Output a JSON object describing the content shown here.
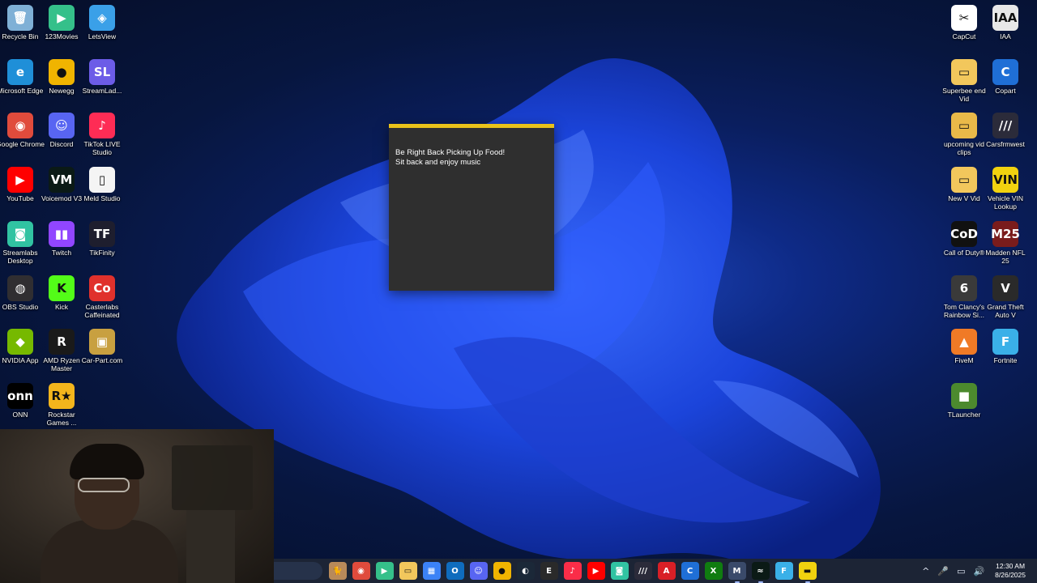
{
  "desktop": {
    "icons_left": [
      {
        "label": "Recycle Bin",
        "glyph": "🗑",
        "color": "#7fb0d6",
        "icon": "recycle-bin-icon"
      },
      {
        "label": "123Movies",
        "glyph": "▶",
        "color": "#35c08a",
        "icon": "123movies-icon"
      },
      {
        "label": "LetsView",
        "glyph": "◈",
        "color": "#3aa0e8",
        "icon": "letsview-icon"
      },
      {
        "label": "Microsoft Edge",
        "glyph": "e",
        "color": "#1f8fd8",
        "icon": "edge-icon"
      },
      {
        "label": "Newegg",
        "glyph": "●",
        "color": "#f0b400",
        "icon": "newegg-icon"
      },
      {
        "label": "StreamLad...",
        "glyph": "SL",
        "color": "#6c5ce7",
        "icon": "streamladder-icon"
      },
      {
        "label": "Google Chrome",
        "glyph": "◉",
        "color": "#e04b3c",
        "icon": "chrome-icon"
      },
      {
        "label": "Discord",
        "glyph": "☺",
        "color": "#5865f2",
        "icon": "discord-icon"
      },
      {
        "label": "TikTok LIVE Studio",
        "glyph": "♪",
        "color": "#fe2c55",
        "icon": "tiktok-live-icon"
      },
      {
        "label": "YouTube",
        "glyph": "▶",
        "color": "#ff0000",
        "icon": "youtube-icon"
      },
      {
        "label": "Voicemod V3",
        "glyph": "VM",
        "color": "#0b1a16",
        "icon": "voicemod-icon"
      },
      {
        "label": "Meld Studio",
        "glyph": "▯",
        "color": "#f4f4f4",
        "icon": "meld-studio-icon"
      },
      {
        "label": "Streamlabs Desktop",
        "glyph": "◙",
        "color": "#31c3a2",
        "icon": "streamlabs-icon"
      },
      {
        "label": "Twitch",
        "glyph": "▮▮",
        "color": "#9146ff",
        "icon": "twitch-icon"
      },
      {
        "label": "TikFinity",
        "glyph": "TF",
        "color": "#1e1e2e",
        "icon": "tikfinity-icon"
      },
      {
        "label": "OBS Studio",
        "glyph": "◍",
        "color": "#302e31",
        "icon": "obs-icon"
      },
      {
        "label": "Kick",
        "glyph": "K",
        "color": "#53fc18",
        "icon": "kick-icon"
      },
      {
        "label": "Casterlabs Caffeinated",
        "glyph": "Co",
        "color": "#e0312c",
        "icon": "casterlabs-icon"
      },
      {
        "label": "NVIDIA App",
        "glyph": "◆",
        "color": "#76b900",
        "icon": "nvidia-icon"
      },
      {
        "label": "AMD Ryzen Master",
        "glyph": "R",
        "color": "#1a1a1a",
        "icon": "ryzen-master-icon"
      },
      {
        "label": "Car-Part.com",
        "glyph": "▣",
        "color": "#c8a040",
        "icon": "car-part-icon"
      },
      {
        "label": "ONN",
        "glyph": "onn",
        "color": "#000000",
        "icon": "onn-icon"
      },
      {
        "label": "Rockstar Games ...",
        "glyph": "R★",
        "color": "#f3b51c",
        "icon": "rockstar-icon"
      }
    ],
    "icons_right": [
      {
        "label": "CapCut",
        "glyph": "✂",
        "color": "#ffffff",
        "icon": "capcut-icon"
      },
      {
        "label": "IAA",
        "glyph": "IAA",
        "color": "#e8e8e8",
        "icon": "iaa-icon"
      },
      {
        "label": "Superbee end Vid",
        "glyph": "▭",
        "color": "#f2c75c",
        "icon": "folder-icon"
      },
      {
        "label": "Copart",
        "glyph": "C",
        "color": "#1f6fd6",
        "icon": "copart-icon"
      },
      {
        "label": "upcoming vid clips",
        "glyph": "▭",
        "color": "#e9b949",
        "icon": "folder-icon"
      },
      {
        "label": "Carsfrmwest",
        "glyph": "///",
        "color": "#2b2b3a",
        "icon": "carsfrmwest-icon"
      },
      {
        "label": "New V Vid",
        "glyph": "▭",
        "color": "#f2c75c",
        "icon": "folder-icon"
      },
      {
        "label": "Vehicle VIN Lookup",
        "glyph": "VIN",
        "color": "#f1d20f",
        "icon": "vin-lookup-icon"
      },
      {
        "label": "Call of Duty®",
        "glyph": "CoD",
        "color": "#111111",
        "icon": "call-of-duty-icon"
      },
      {
        "label": "Madden NFL 25",
        "glyph": "M25",
        "color": "#7a1c1c",
        "icon": "madden-icon"
      },
      {
        "label": "Tom Clancy's Rainbow Si...",
        "glyph": "6",
        "color": "#3a3a3a",
        "icon": "rainbow-six-icon"
      },
      {
        "label": "Grand Theft Auto V",
        "glyph": "V",
        "color": "#2a2a2a",
        "icon": "gta-icon"
      },
      {
        "label": "FiveM",
        "glyph": "▲",
        "color": "#f07a26",
        "icon": "fivem-icon"
      },
      {
        "label": "Fortnite",
        "glyph": "F",
        "color": "#3ab0e8",
        "icon": "fortnite-icon"
      },
      {
        "label": "TLauncher",
        "glyph": "■",
        "color": "#4c8a2e",
        "icon": "tlauncher-icon"
      }
    ]
  },
  "note": {
    "line1": "Be Right Back Picking Up Food!",
    "line2": "Sit back and enjoy music"
  },
  "taskbar": {
    "apps": [
      {
        "icon": "game-bar-icon",
        "glyph": "🐈",
        "color": "#b88a5a",
        "active": false
      },
      {
        "icon": "chrome-taskbar-icon",
        "glyph": "◉",
        "color": "#e04b3c",
        "active": false
      },
      {
        "icon": "play-icon",
        "glyph": "▶",
        "color": "#35c08a",
        "active": false
      },
      {
        "icon": "file-explorer-icon",
        "glyph": "▭",
        "color": "#f2c75c",
        "active": false
      },
      {
        "icon": "store-icon",
        "glyph": "▦",
        "color": "#3b82f6",
        "active": false
      },
      {
        "icon": "outlook-icon",
        "glyph": "O",
        "color": "#0f6cbd",
        "active": false
      },
      {
        "icon": "discord-taskbar-icon",
        "glyph": "☺",
        "color": "#5865f2",
        "active": false
      },
      {
        "icon": "newegg-taskbar-icon",
        "glyph": "●",
        "color": "#f0b400",
        "active": false
      },
      {
        "icon": "steam-icon",
        "glyph": "◐",
        "color": "#1b2838",
        "active": false
      },
      {
        "icon": "epic-games-icon",
        "glyph": "E",
        "color": "#2a2a2a",
        "active": false
      },
      {
        "icon": "music-icon",
        "glyph": "♪",
        "color": "#fa2d48",
        "active": false
      },
      {
        "icon": "youtube-taskbar-icon",
        "glyph": "▶",
        "color": "#ff0000",
        "active": false
      },
      {
        "icon": "streamlabs-taskbar-icon",
        "glyph": "◙",
        "color": "#31c3a2",
        "active": false
      },
      {
        "icon": "carsfrmwest-taskbar-icon",
        "glyph": "///",
        "color": "#2b2b3a",
        "active": false
      },
      {
        "icon": "iaa-taskbar-icon",
        "glyph": "A",
        "color": "#d81f26",
        "active": false
      },
      {
        "icon": "copart-taskbar-icon",
        "glyph": "C",
        "color": "#1f6fd6",
        "active": false
      },
      {
        "icon": "xbox-icon",
        "glyph": "X",
        "color": "#107c10",
        "active": false
      },
      {
        "icon": "meld-taskbar-icon",
        "glyph": "M",
        "color": "#3a4a6a",
        "active": true
      },
      {
        "icon": "voicemod-taskbar-icon",
        "glyph": "≈",
        "color": "#0b1a16",
        "active": true
      },
      {
        "icon": "fortnite-taskbar-icon",
        "glyph": "F",
        "color": "#3ab0e8",
        "active": false
      },
      {
        "icon": "sticky-notes-icon",
        "glyph": "▬",
        "color": "#f1d20f",
        "active": true
      }
    ],
    "tray": {
      "chevron": "^",
      "mic": "🎤",
      "network": "▭",
      "volume": "🔊",
      "time": "12:30 AM",
      "date": "8/26/2025"
    }
  }
}
